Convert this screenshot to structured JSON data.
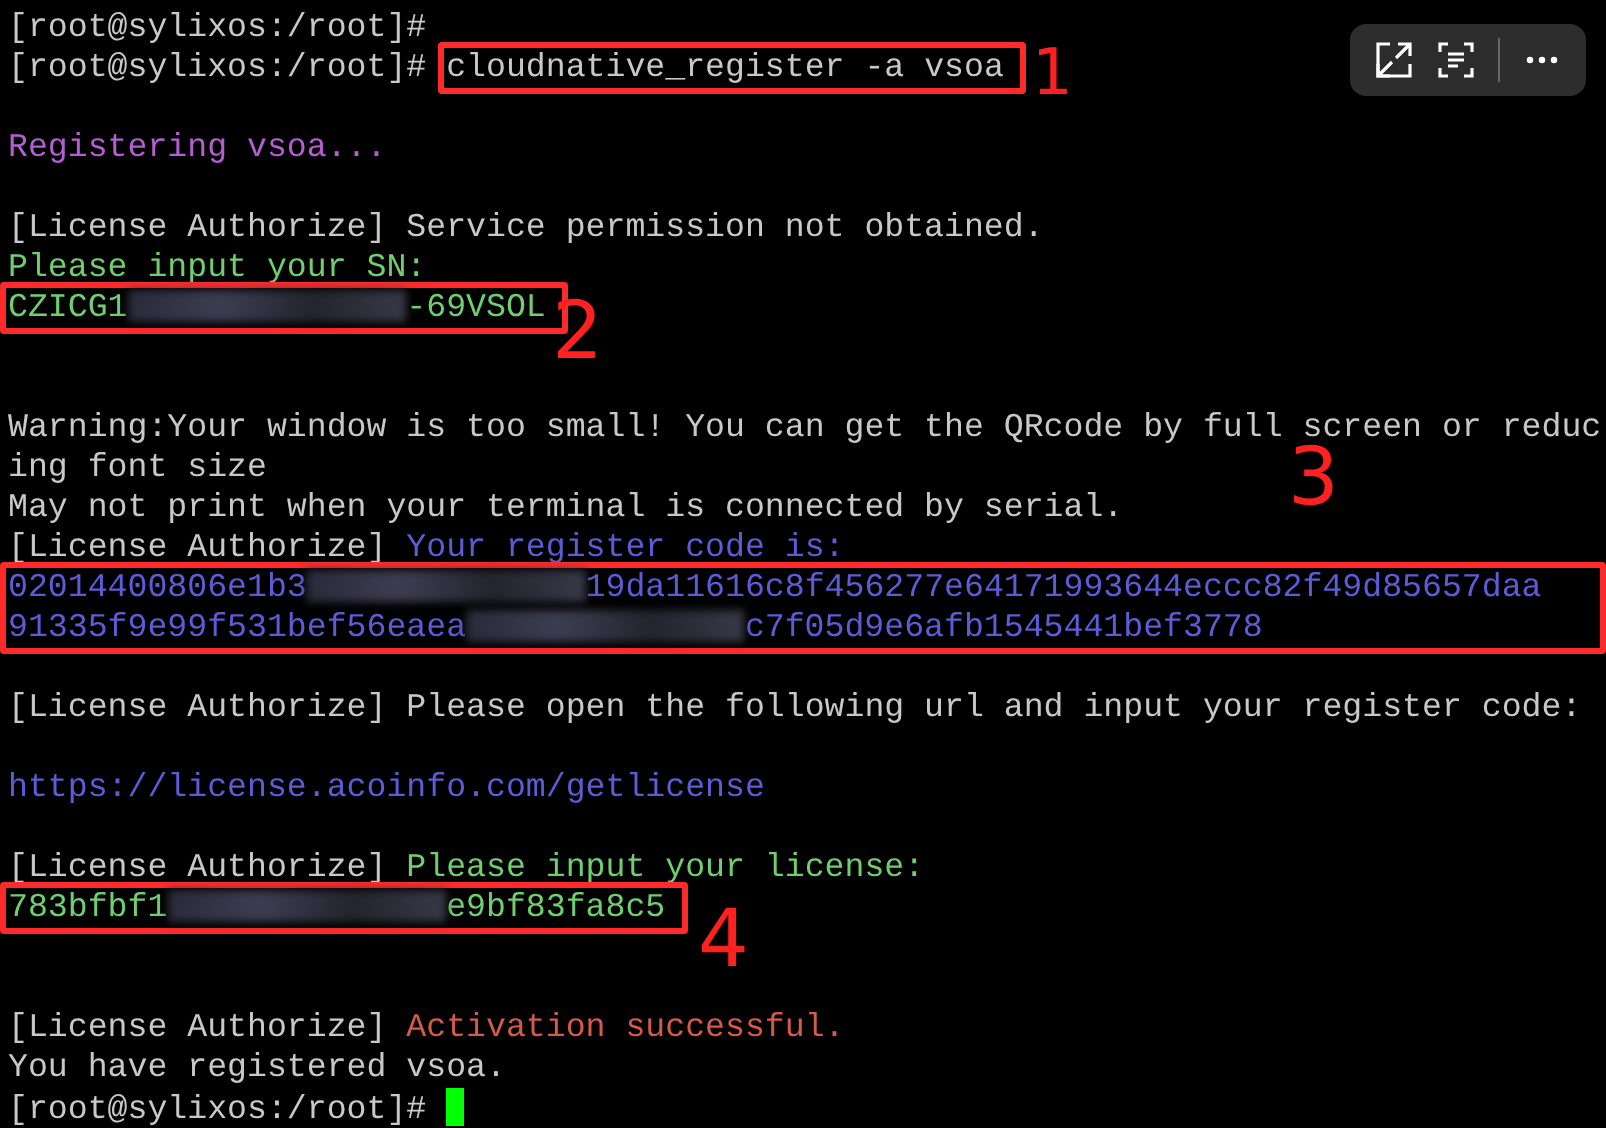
{
  "terminal": {
    "lines": [
      {
        "segments": [
          {
            "kind": "text",
            "text": "[root@sylixos:/root]#",
            "color": "#c8c8c8"
          }
        ]
      },
      {
        "kind": "output",
        "segments": [
          {
            "kind": "text",
            "text": "[root@sylixos:/root]# ",
            "color": "#c8c8c8"
          }
        ],
        "annotation": {
          "marker": "1",
          "lines": [
            [
              {
                "kind": "text",
                "text": "cloudnative_register -a vsoa",
                "color": "#c8c8c8"
              }
            ]
          ]
        }
      },
      {
        "kind": "blank"
      },
      {
        "kind": "output",
        "segments": [
          {
            "kind": "text",
            "text": "Registering vsoa...",
            "color": "#b45fd1"
          }
        ]
      },
      {
        "kind": "blank"
      },
      {
        "segments": [
          {
            "kind": "text",
            "text": "[License Authorize] Service permission not obtained.",
            "color": "#c8c8c8"
          }
        ]
      },
      {
        "segments": [
          {
            "kind": "text",
            "text": "Please input your SN:",
            "color": "#6fcf6f"
          }
        ]
      },
      {
        "kind": "output",
        "annotation": {
          "marker": "2",
          "lines": [
            [
              {
                "kind": "text",
                "text": "CZICG1",
                "color": "#6fcf6f"
              },
              {
                "kind": "redacted"
              },
              {
                "kind": "text",
                "text": "-69VSOL",
                "color": "#6fcf6f"
              }
            ]
          ]
        }
      },
      {
        "kind": "blank"
      },
      {
        "kind": "blank"
      },
      {
        "segments": [
          {
            "kind": "text",
            "text": "Warning:Your window is too small! You can get the QRcode by full screen or reduc",
            "color": "#c8c8c8"
          }
        ]
      },
      {
        "segments": [
          {
            "kind": "text",
            "text": "ing font size",
            "color": "#c8c8c8"
          }
        ]
      },
      {
        "segments": [
          {
            "kind": "text",
            "text": "May not print when your terminal is connected by serial.",
            "color": "#c8c8c8"
          }
        ]
      },
      {
        "segments": [
          {
            "kind": "text",
            "text": "[License Authorize] ",
            "color": "#c8c8c8"
          },
          {
            "kind": "text",
            "text": "Your register code is:",
            "color": "#5c5cd6"
          }
        ]
      },
      {
        "kind": "output",
        "annotation": {
          "marker": "3",
          "lines": [
            [
              {
                "kind": "text",
                "text": "02014400806e1b3",
                "color": "#5c5cd6"
              },
              {
                "kind": "redacted"
              },
              {
                "kind": "text",
                "text": "19da11616c8f456277e64171993644eccc82f49d85657daa",
                "color": "#5c5cd6"
              }
            ],
            [
              {
                "kind": "text",
                "text": "91335f9e99f531bef56eaea",
                "color": "#5c5cd6"
              },
              {
                "kind": "redacted"
              },
              {
                "kind": "text",
                "text": "c7f05d9e6afb1545441bef3778",
                "color": "#5c5cd6"
              }
            ]
          ]
        }
      },
      {
        "kind": "blank"
      },
      {
        "segments": [
          {
            "kind": "text",
            "text": "[License Authorize] Please open the following url and input your register code:",
            "color": "#c8c8c8"
          }
        ]
      },
      {
        "kind": "blank"
      },
      {
        "kind": "output",
        "segments": [
          {
            "kind": "link",
            "text": "https://license.acoinfo.com/getlicense",
            "color": "#5c5cd6"
          }
        ]
      },
      {
        "kind": "blank"
      },
      {
        "segments": [
          {
            "kind": "text",
            "text": "[License Authorize] ",
            "color": "#c8c8c8"
          },
          {
            "kind": "text",
            "text": "Please input your license:",
            "color": "#6fcf6f"
          }
        ]
      },
      {
        "kind": "output",
        "annotation": {
          "marker": "4",
          "lines": [
            [
              {
                "kind": "text",
                "text": "783bfbf1",
                "color": "#6fcf6f"
              },
              {
                "kind": "redacted"
              },
              {
                "kind": "text",
                "text": "e9bf83fa8c5",
                "color": "#6fcf6f"
              }
            ]
          ]
        }
      },
      {
        "kind": "blank"
      },
      {
        "kind": "blank"
      },
      {
        "segments": [
          {
            "kind": "text",
            "text": "[License Authorize] ",
            "color": "#c8c8c8"
          },
          {
            "kind": "text",
            "text": "Activation successful.",
            "color": "#d65a4a"
          }
        ]
      },
      {
        "segments": [
          {
            "kind": "text",
            "text": "You have registered vsoa.",
            "color": "#c8c8c8"
          }
        ]
      },
      {
        "segments": [
          {
            "kind": "text",
            "text": "[root@sylixos:/root]# ",
            "color": "#c8c8c8"
          },
          {
            "kind": "cursor"
          }
        ]
      }
    ]
  }
}
